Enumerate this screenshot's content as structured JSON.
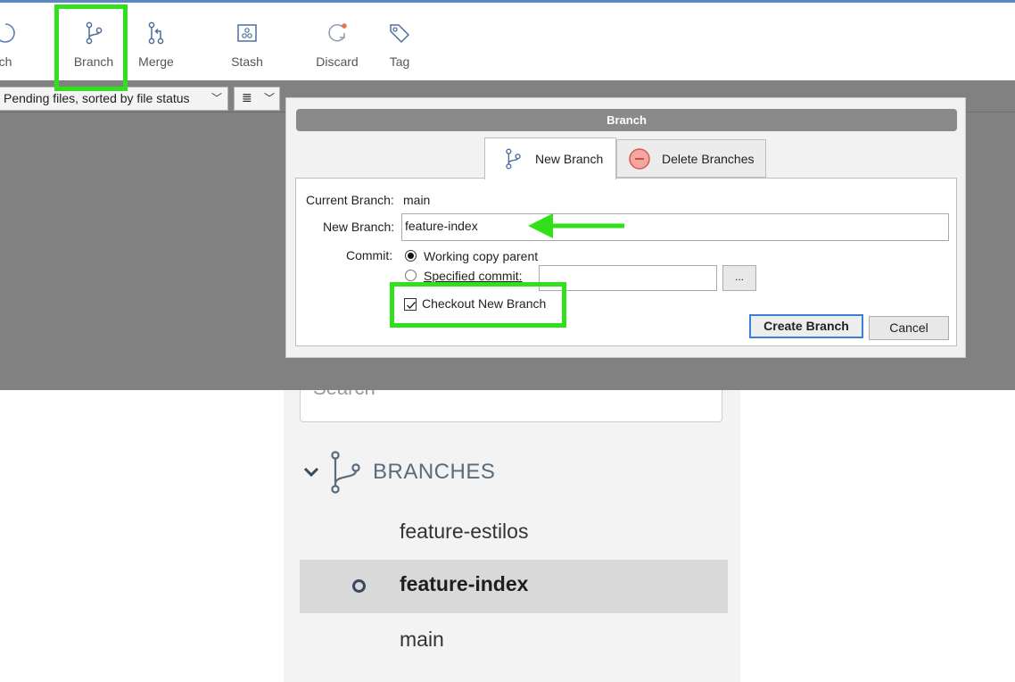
{
  "toolbar": {
    "items": [
      {
        "label": "ch",
        "icon": "fetch-icon"
      },
      {
        "label": "Branch",
        "icon": "branch-icon"
      },
      {
        "label": "Merge",
        "icon": "merge-icon"
      },
      {
        "label": "Stash",
        "icon": "stash-icon"
      },
      {
        "label": "Discard",
        "icon": "discard-icon"
      },
      {
        "label": "Tag",
        "icon": "tag-icon"
      }
    ]
  },
  "filterbar": {
    "file_filter": "Pending files, sorted by file status",
    "view_symbol": "≣"
  },
  "dialog": {
    "title": "Branch",
    "tabs": [
      {
        "label": "New Branch",
        "icon": "branch-icon",
        "active": true
      },
      {
        "label": "Delete Branches",
        "icon": "minus-circle-icon",
        "active": false
      }
    ],
    "current_branch_label": "Current Branch:",
    "current_branch_value": "main",
    "new_branch_label": "New Branch:",
    "new_branch_value": "feature-index",
    "commit_label": "Commit:",
    "commit_options": [
      "Working copy parent",
      "Specified commit:"
    ],
    "selected_commit_option": "Working copy parent",
    "specified_commit_value": "",
    "browse_label": "...",
    "checkout_label": "Checkout New Branch",
    "checkout_checked": true,
    "create_button": "Create Branch",
    "cancel_button": "Cancel"
  },
  "sidebar": {
    "search_placeholder": "Search",
    "section_title": "BRANCHES",
    "branches": [
      {
        "name": "feature-estilos",
        "current": false
      },
      {
        "name": "feature-index",
        "current": true
      },
      {
        "name": "main",
        "current": false
      }
    ]
  },
  "colors": {
    "highlight": "#31e01a",
    "accent_blue": "#5a88bf",
    "primary_button_border": "#3b80d6"
  }
}
